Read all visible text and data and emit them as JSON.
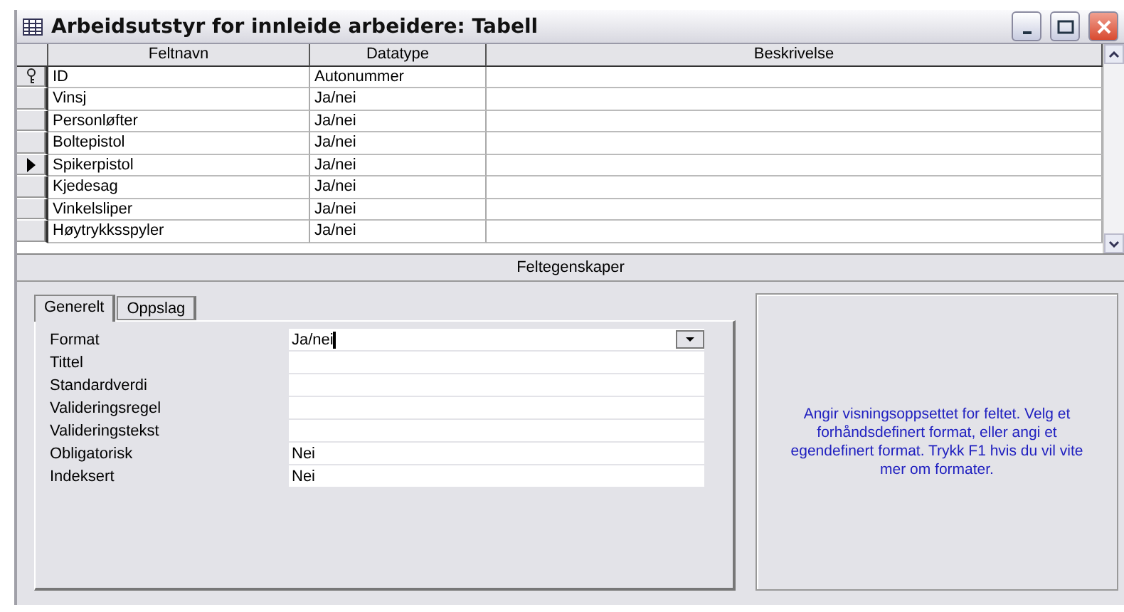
{
  "window": {
    "title": "Arbeidsutstyr for innleide arbeidere: Tabell"
  },
  "table": {
    "columns": [
      "Feltnavn",
      "Datatype",
      "Beskrivelse"
    ],
    "rows": [
      {
        "name": "ID",
        "type": "Autonummer",
        "primary_key": true,
        "selected": false
      },
      {
        "name": "Vinsj",
        "type": "Ja/nei",
        "primary_key": false,
        "selected": false
      },
      {
        "name": "Personløfter",
        "type": "Ja/nei",
        "primary_key": false,
        "selected": false
      },
      {
        "name": "Boltepistol",
        "type": "Ja/nei",
        "primary_key": false,
        "selected": false
      },
      {
        "name": "Spikerpistol",
        "type": "Ja/nei",
        "primary_key": false,
        "selected": true
      },
      {
        "name": "Kjedesag",
        "type": "Ja/nei",
        "primary_key": false,
        "selected": false
      },
      {
        "name": "Vinkelsliper",
        "type": "Ja/nei",
        "primary_key": false,
        "selected": false
      },
      {
        "name": "Høytrykksspyler",
        "type": "Ja/nei",
        "primary_key": false,
        "selected": false
      }
    ]
  },
  "properties_title": "Feltegenskaper",
  "tabs": [
    {
      "label": "Generelt",
      "selected": true
    },
    {
      "label": "Oppslag",
      "selected": false
    }
  ],
  "properties": [
    {
      "label": "Format",
      "value": "Ja/nei",
      "kind": "dropdown"
    },
    {
      "label": "Tittel",
      "kind": "text"
    },
    {
      "label": "Standardverdi",
      "kind": "text"
    },
    {
      "label": "Valideringsregel",
      "kind": "text"
    },
    {
      "label": "Valideringstekst",
      "kind": "text"
    },
    {
      "label": "Obligatorisk",
      "value": "Nei",
      "kind": "text"
    },
    {
      "label": "Indeksert",
      "value": "Nei",
      "kind": "text"
    }
  ],
  "help_text": "Angir visningsoppsettet for feltet. Velg et forhåndsdefinert format, eller angi et egendefinert format. Trykk F1 hvis du vil vite mer om formater."
}
